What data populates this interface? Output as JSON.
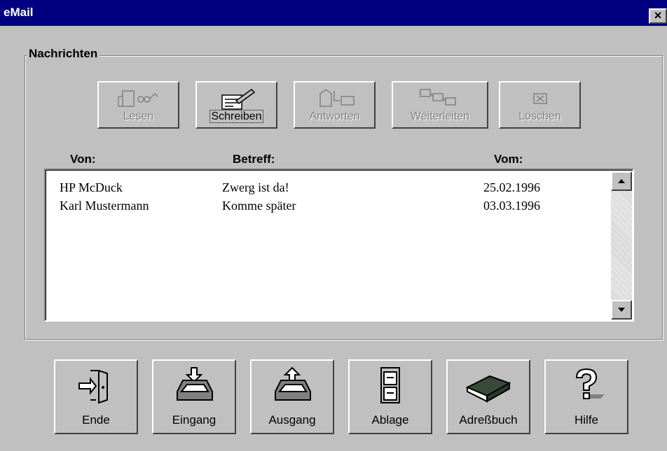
{
  "window": {
    "title": "eMail",
    "close_label": "×"
  },
  "group": {
    "label": "Nachrichten"
  },
  "toolbar": [
    {
      "label": "Lesen",
      "enabled": false,
      "icon": "read-icon"
    },
    {
      "label": "Schreiben",
      "enabled": true,
      "icon": "write-icon"
    },
    {
      "label": "Antworten",
      "enabled": false,
      "icon": "reply-icon"
    },
    {
      "label": "Weiterleiten",
      "enabled": false,
      "icon": "forward-icon"
    },
    {
      "label": "Löschen",
      "enabled": false,
      "icon": "delete-icon"
    }
  ],
  "columns": {
    "from": "Von:",
    "subject": "Betreff:",
    "date": "Vom:"
  },
  "messages": [
    {
      "from": "HP McDuck",
      "subject": "Zwerg ist da!",
      "date": "25.02.1996"
    },
    {
      "from": "Karl Mustermann",
      "subject": "Komme später",
      "date": "03.03.1996"
    }
  ],
  "bottom_buttons": [
    {
      "label": "Ende",
      "icon": "exit-door-icon"
    },
    {
      "label": "Eingang",
      "icon": "inbox-tray-icon"
    },
    {
      "label": "Ausgang",
      "icon": "outbox-tray-icon"
    },
    {
      "label": "Ablage",
      "icon": "file-cabinet-icon"
    },
    {
      "label": "Adreßbuch",
      "icon": "address-book-icon"
    },
    {
      "label": "Hilfe",
      "icon": "help-icon"
    }
  ]
}
